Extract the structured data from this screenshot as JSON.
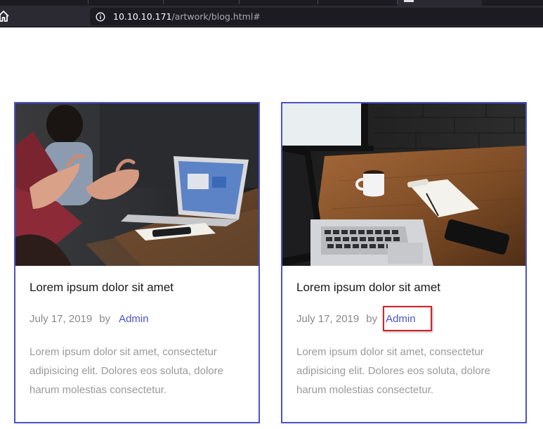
{
  "browser": {
    "url_host": "10.10.10.171",
    "url_path": "/artwork/blog.html#"
  },
  "cards": [
    {
      "title": "Lorem ipsum dolor sit amet",
      "date": "July 17, 2019",
      "by_label": "by",
      "author": "Admin",
      "excerpt": "Lorem ipsum dolor sit amet, consectetur adipisicing elit. Dolores eos soluta, dolore harum molestias consectetur.",
      "image": "meeting-laptop-photo"
    },
    {
      "title": "Lorem ipsum dolor sit amet",
      "date": "July 17, 2019",
      "by_label": "by",
      "author": "Admin",
      "excerpt": "Lorem ipsum dolor sit amet, consectetur adipisicing elit. Dolores eos soluta, dolore harum molestias consectetur.",
      "image": "desk-laptop-coffee-photo"
    }
  ],
  "colors": {
    "card_border": "#4c52c7",
    "link": "#4c52c7",
    "highlight": "#d81f26"
  }
}
